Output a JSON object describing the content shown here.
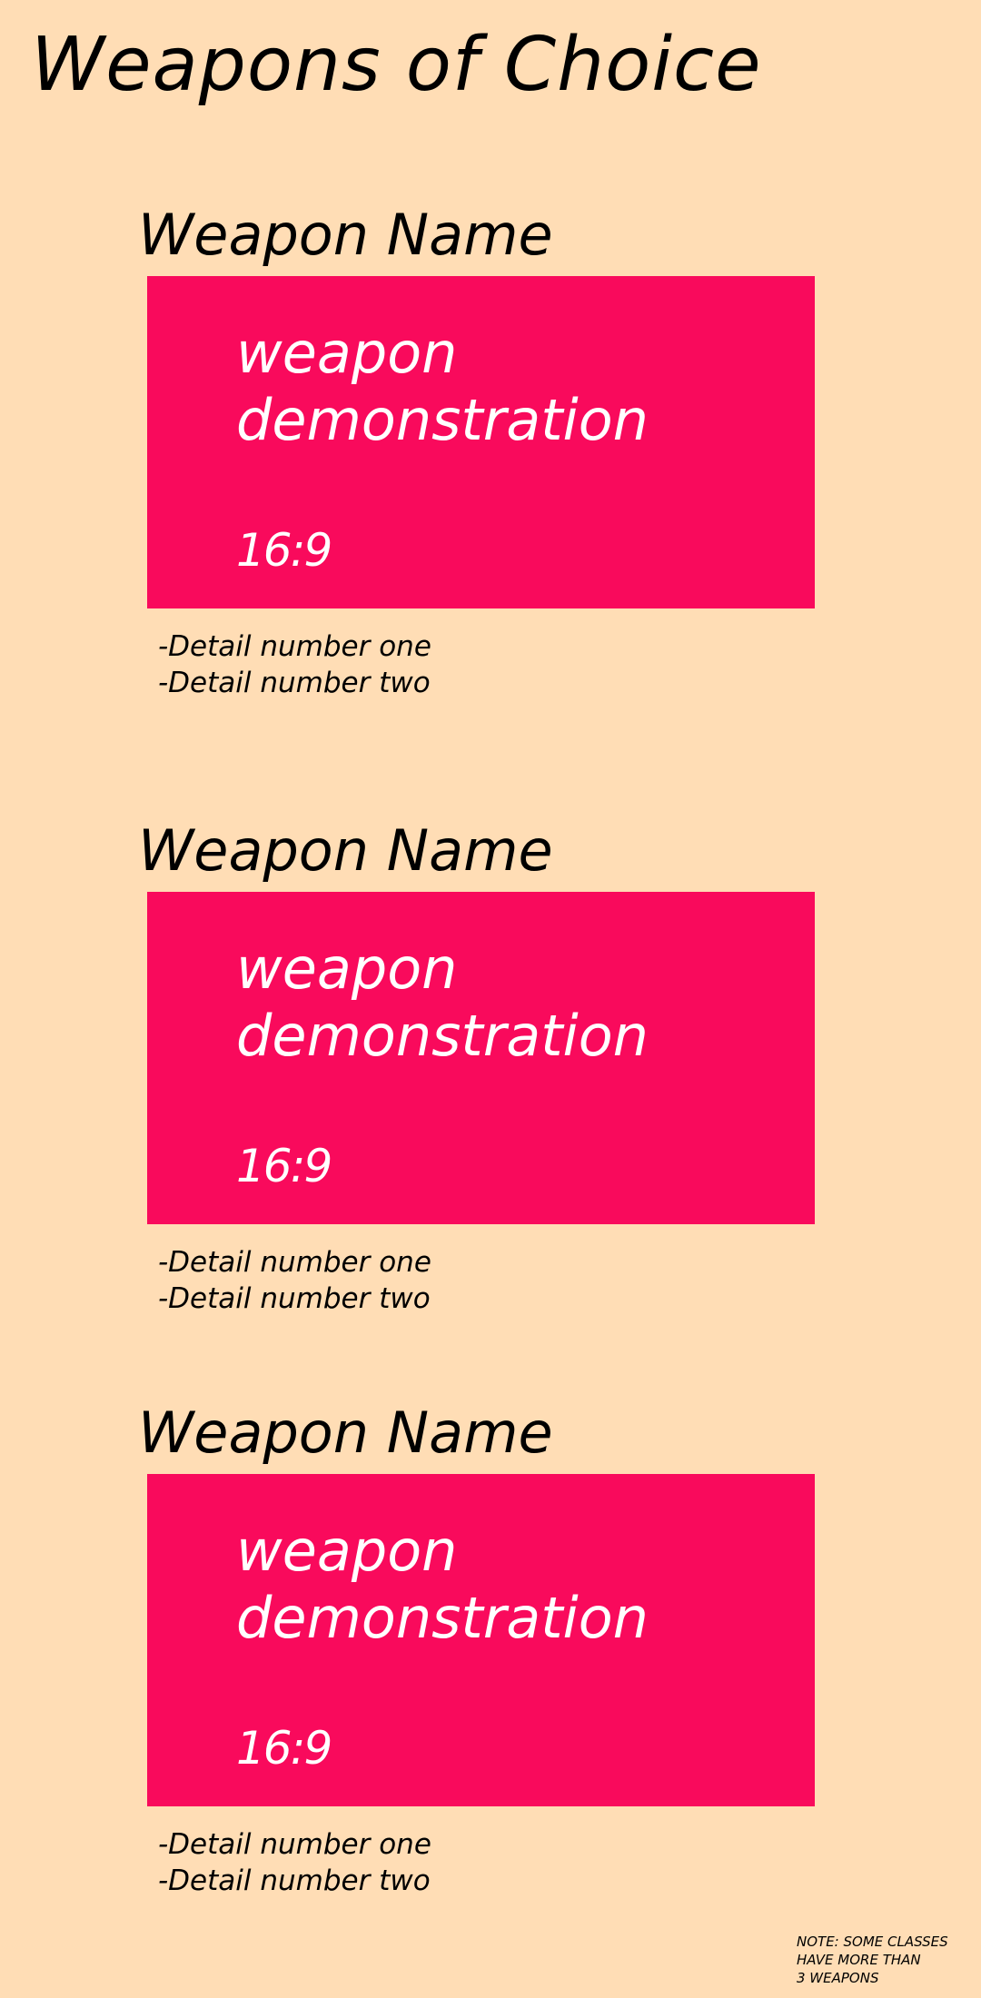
{
  "page": {
    "title": "Weapons of Choice"
  },
  "weapons": [
    {
      "name": "Weapon Name",
      "demo_text": "weapon demonstration",
      "demo_ratio": "16:9",
      "details": [
        "-Detail number one",
        "-Detail number two"
      ]
    },
    {
      "name": "Weapon Name",
      "demo_text": "weapon demonstration",
      "demo_ratio": "16:9",
      "details": [
        "-Detail number one",
        "-Detail number two"
      ]
    },
    {
      "name": "Weapon Name",
      "demo_text": "weapon demonstration",
      "demo_ratio": "16:9",
      "details": [
        "-Detail number one",
        "-Detail number two"
      ]
    }
  ],
  "note": {
    "lines": [
      "NOTE: SOME CLASSES",
      "HAVE MORE THAN",
      "3 WEAPONS"
    ]
  },
  "colors": {
    "background": "#FFDDB5",
    "demo_box": "#F90A5C",
    "demo_text": "#FFFFFF",
    "text": "#000000"
  }
}
